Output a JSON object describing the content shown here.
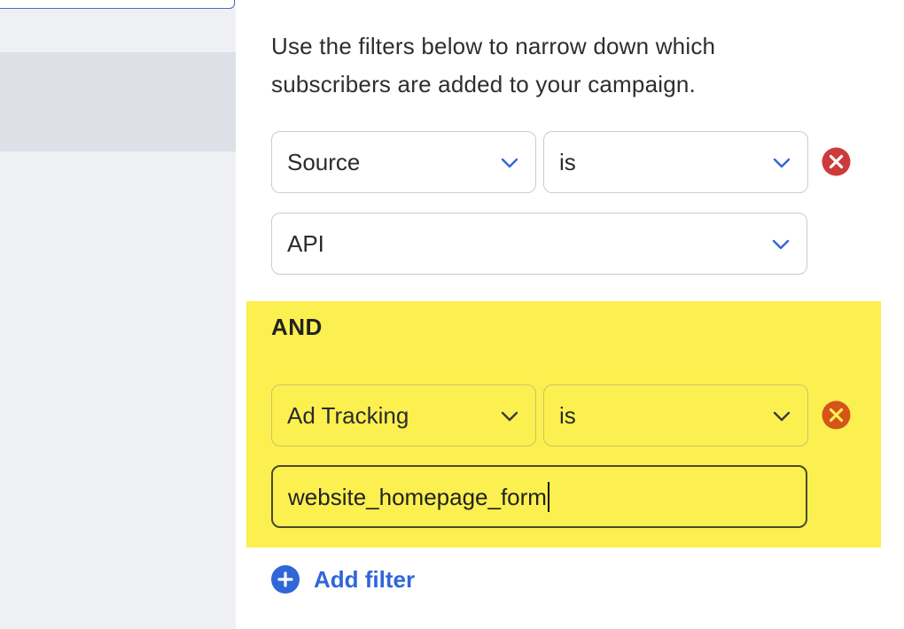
{
  "intro": {
    "line1": "Use the filters below to narrow down which",
    "line2": "subscribers are added to your campaign."
  },
  "filter1": {
    "field": "Source",
    "operator": "is",
    "value": "API"
  },
  "group": {
    "conjunction": "AND",
    "field": "Ad Tracking",
    "operator": "is",
    "value": "website_homepage_form"
  },
  "add_filter": {
    "label": "Add filter"
  },
  "colors": {
    "accent": "#2f66d8",
    "highlight": "#fbf04f",
    "remove_red": "#cc3b3b",
    "remove_orange": "#d4541a"
  }
}
